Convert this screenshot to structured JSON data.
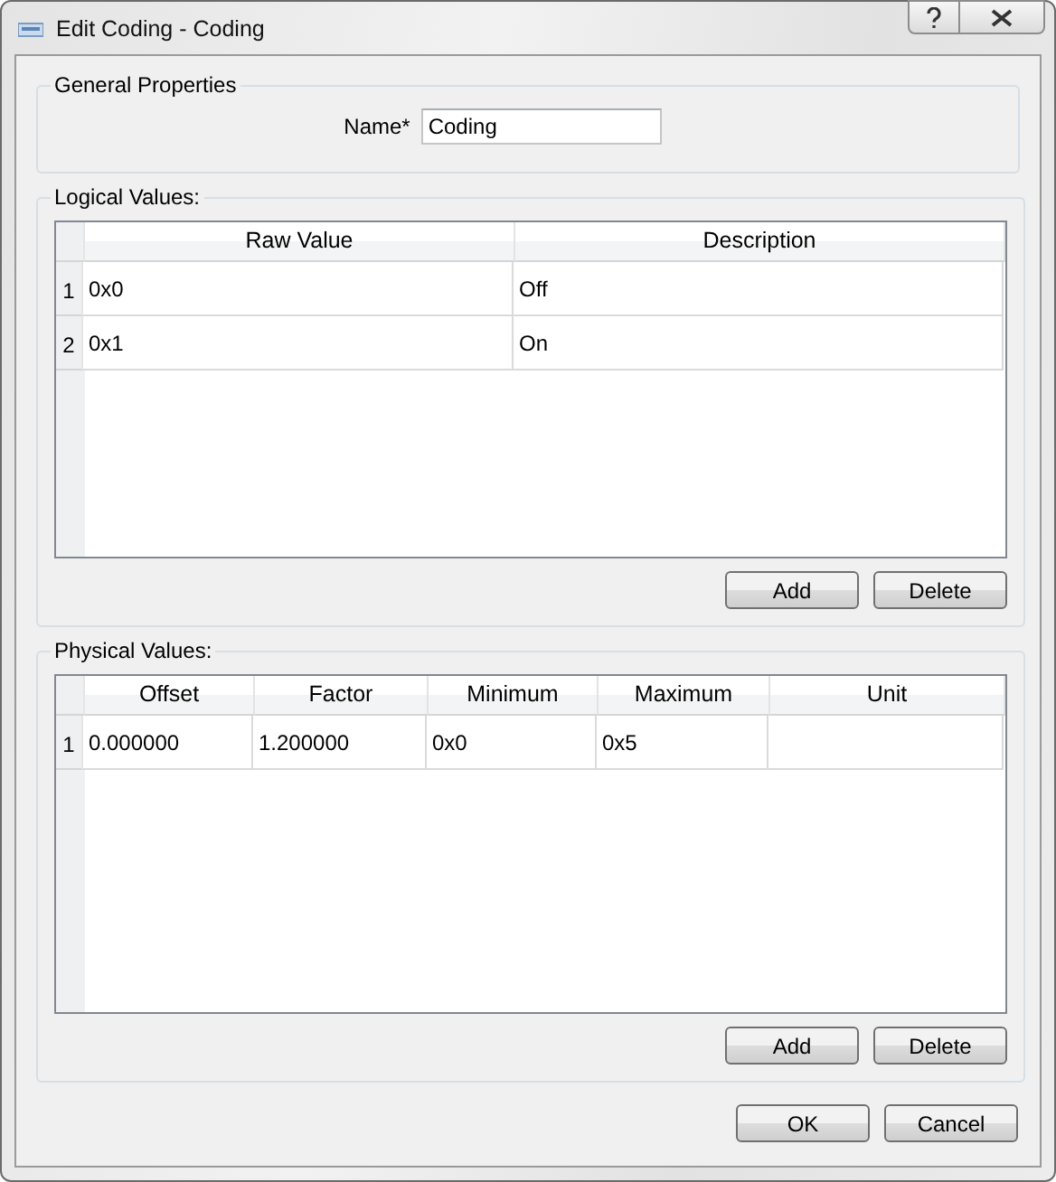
{
  "window": {
    "title": "Edit Coding - Coding"
  },
  "general": {
    "title": "General Properties",
    "name_label": "Name*",
    "name_value": "Coding"
  },
  "logical": {
    "title": "Logical Values:",
    "columns": [
      "Raw Value",
      "Description"
    ],
    "rows": [
      {
        "index": "1",
        "cells": [
          "0x0",
          "Off"
        ]
      },
      {
        "index": "2",
        "cells": [
          "0x1",
          "On"
        ]
      }
    ],
    "buttons": [
      "Add",
      "Delete"
    ]
  },
  "physical": {
    "title": "Physical Values:",
    "columns": [
      "Offset",
      "Factor",
      "Minimum",
      "Maximum",
      "Unit"
    ],
    "rows": [
      {
        "index": "1",
        "cells": [
          "0.000000",
          "1.200000",
          "0x0",
          "0x5"
        ]
      }
    ],
    "buttons": [
      "Add",
      "Delete"
    ]
  },
  "footer": {
    "buttons": [
      "OK",
      "Cancel"
    ]
  }
}
